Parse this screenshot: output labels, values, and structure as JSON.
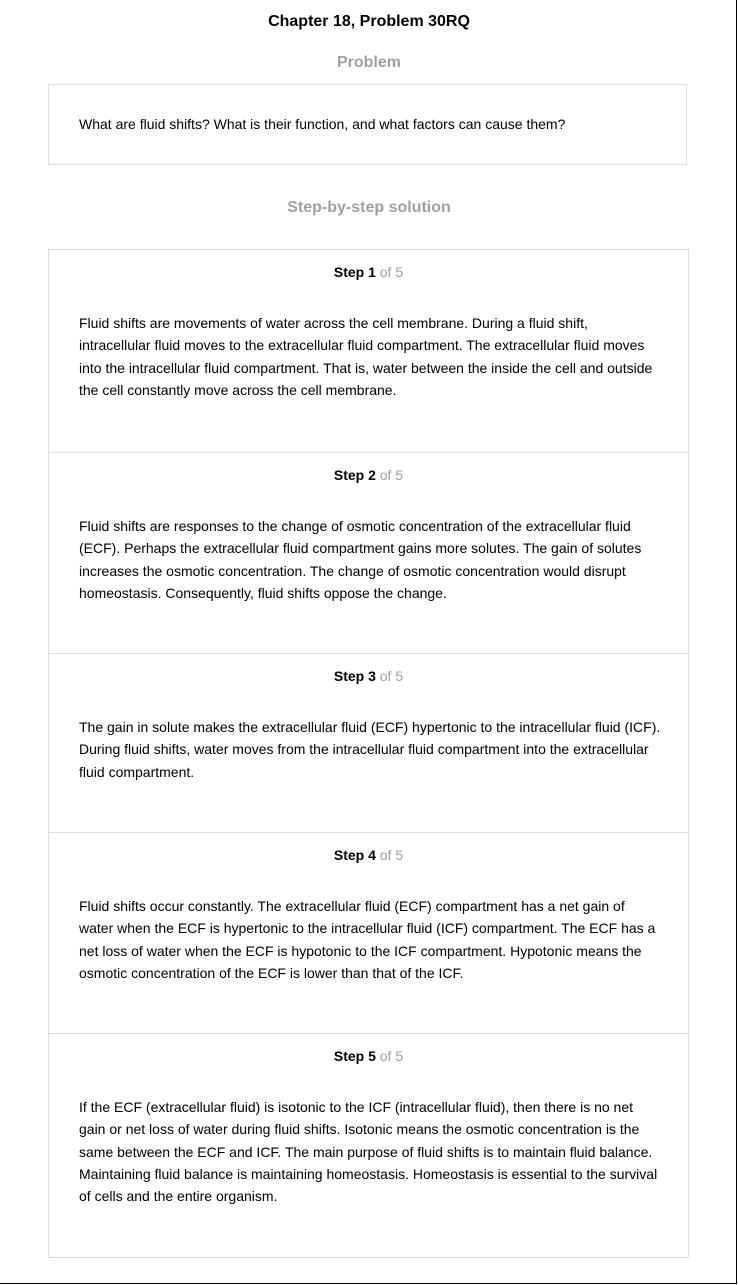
{
  "title": "Chapter 18, Problem 30RQ",
  "problem": {
    "heading": "Problem",
    "text": "What are fluid shifts? What is their function, and what factors can cause them?"
  },
  "solution": {
    "heading": "Step-by-step solution",
    "steps": [
      {
        "label": "Step 1",
        "of": "of 5",
        "text": "Fluid shifts are movements of water across the cell membrane. During a fluid shift, intracellular fluid moves to the extracellular fluid compartment. The extracellular fluid moves into the intracellular fluid compartment. That is, water between the inside the cell and outside the cell constantly move across the cell membrane."
      },
      {
        "label": "Step 2",
        "of": "of 5",
        "text": "Fluid shifts are responses to the change of osmotic concentration of the extracellular fluid (ECF). Perhaps the extracellular fluid compartment gains more solutes. The gain of solutes increases the osmotic concentration. The change of osmotic concentration would disrupt homeostasis. Consequently, fluid shifts oppose the change."
      },
      {
        "label": "Step 3",
        "of": "of 5",
        "text": "The gain in solute makes the extracellular fluid (ECF) hypertonic to the intracellular fluid (ICF). During fluid shifts, water moves from the intracellular fluid compartment into the extracellular fluid compartment."
      },
      {
        "label": "Step 4",
        "of": "of 5",
        "text": "Fluid shifts occur constantly. The extracellular fluid (ECF) compartment has a net gain of water when the ECF is hypertonic to the intracellular fluid (ICF) compartment. The ECF has a net loss of water when the ECF is hypotonic to the ICF compartment. Hypotonic means the osmotic concentration of the ECF is lower than that of the ICF."
      },
      {
        "label": "Step 5",
        "of": "of 5",
        "text": "If the ECF (extracellular fluid) is isotonic to the ICF (intracellular fluid), then there is no net gain or net loss of water during fluid shifts. Isotonic means the osmotic concentration is the same between the ECF and ICF. The main purpose of fluid shifts is to maintain fluid balance. Maintaining fluid balance is maintaining homeostasis. Homeostasis is essential to the survival of cells and the entire organism."
      }
    ]
  }
}
